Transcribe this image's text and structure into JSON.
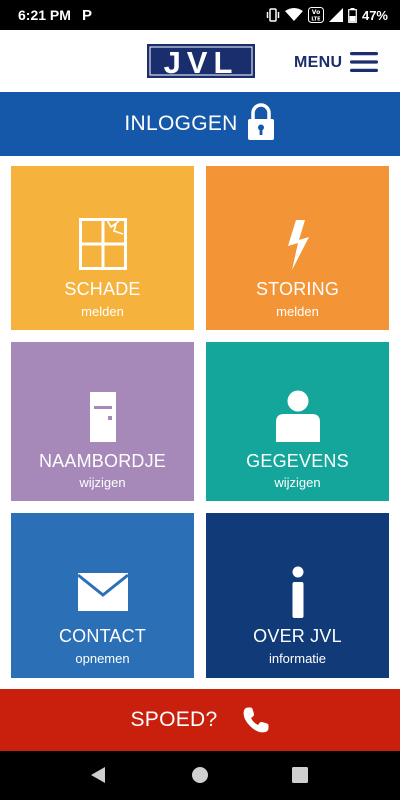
{
  "status_bar": {
    "time": "6:21 PM",
    "notification_letter": "P",
    "battery_percent": "47%",
    "volte_badge": "Vo LTE"
  },
  "header": {
    "logo_text": "JVL",
    "menu_label": "MENU"
  },
  "login": {
    "label": "INLOGGEN"
  },
  "tiles": [
    {
      "title": "SCHADE",
      "subtitle": "melden",
      "color": "#f5b23c",
      "icon": "broken-window-icon"
    },
    {
      "title": "STORING",
      "subtitle": "melden",
      "color": "#f39437",
      "icon": "lightning-icon"
    },
    {
      "title": "NAAMBORDJE",
      "subtitle": "wijzigen",
      "color": "#a688b9",
      "icon": "door-icon"
    },
    {
      "title": "GEGEVENS",
      "subtitle": "wijzigen",
      "color": "#14a69a",
      "icon": "person-icon"
    },
    {
      "title": "CONTACT",
      "subtitle": "opnemen",
      "color": "#2b6fb7",
      "icon": "envelope-icon"
    },
    {
      "title": "OVER JVL",
      "subtitle": "informatie",
      "color": "#113a78",
      "icon": "info-icon"
    }
  ],
  "emergency": {
    "label": "SPOED?"
  },
  "colors": {
    "brand_blue": "#1558a9",
    "navy": "#1a2e6e",
    "emergency_red": "#c9200d"
  }
}
